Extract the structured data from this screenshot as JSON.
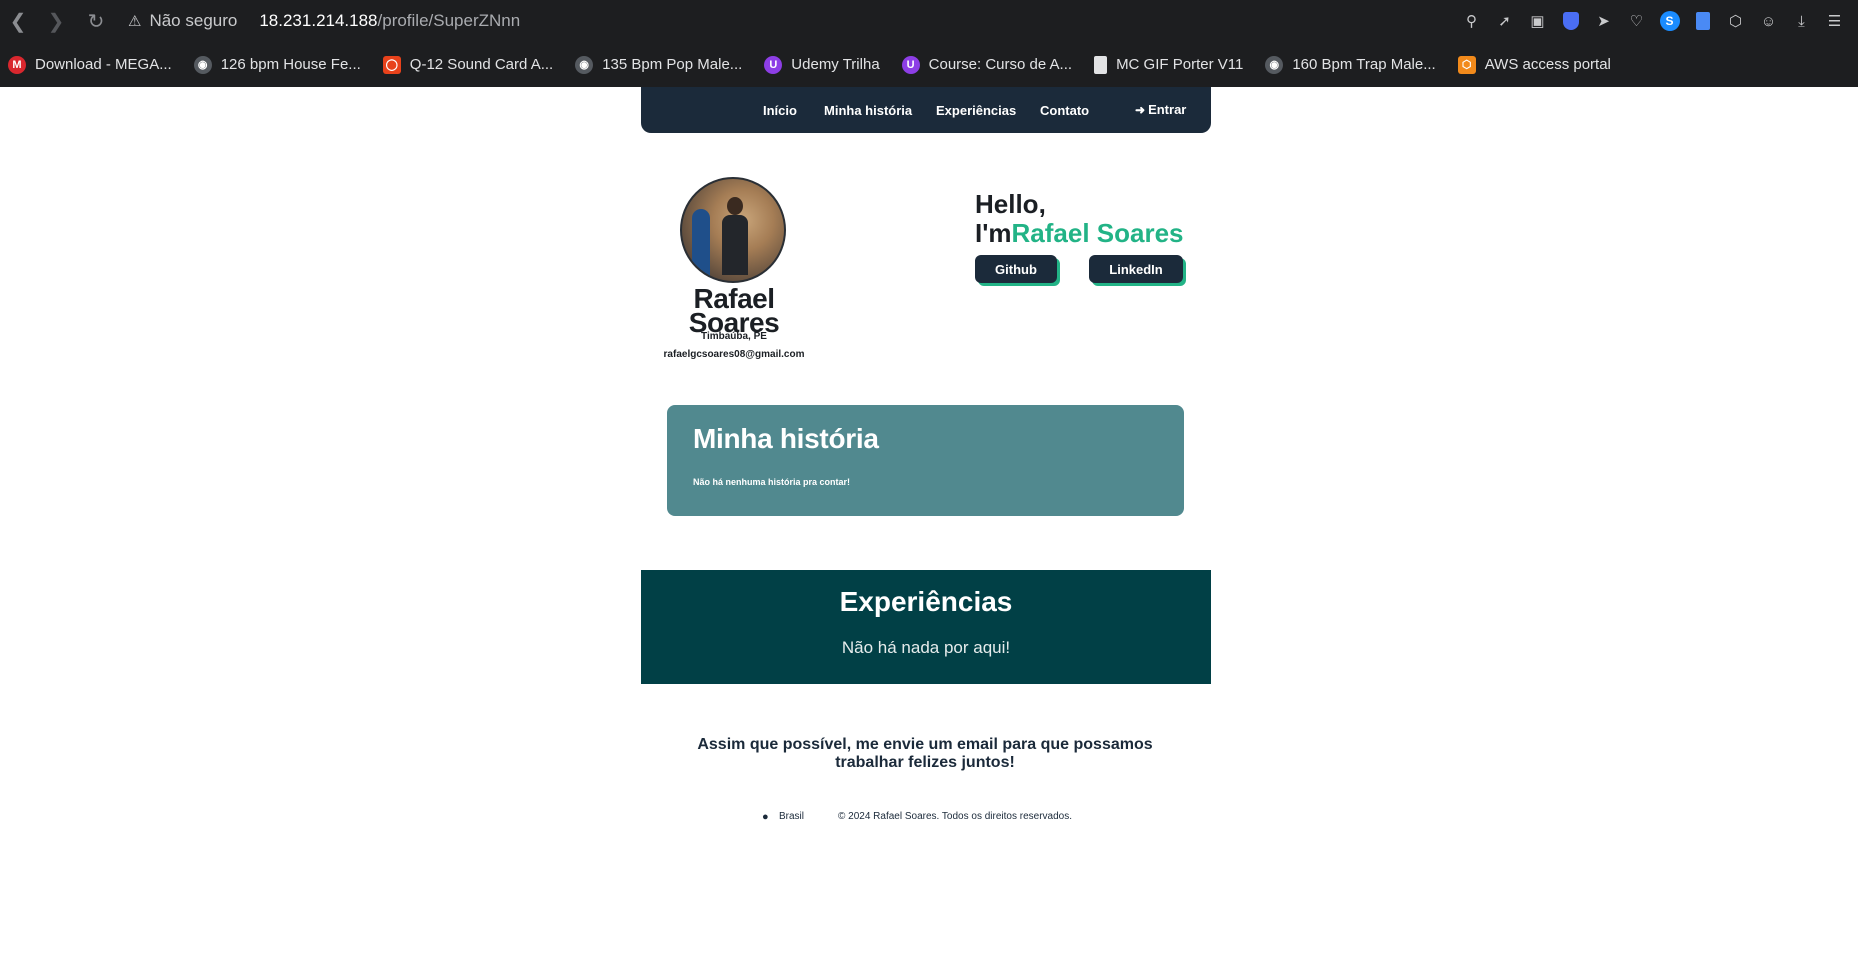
{
  "browser": {
    "security_label": "Não seguro",
    "url_host": "18.231.214.188",
    "url_path": "/profile/SuperZNnn",
    "bookmarks": [
      {
        "label": "Download - MEGA...",
        "icon": "mega-icon",
        "color": "#d9272e"
      },
      {
        "label": "126 bpm House Fe...",
        "icon": "cartoon-icon",
        "color": "#555a60"
      },
      {
        "label": "Q-12 Sound Card A...",
        "icon": "aliexpress-icon",
        "color": "#e8421b"
      },
      {
        "label": "135 Bpm Pop Male...",
        "icon": "cartoon-icon",
        "color": "#555a60"
      },
      {
        "label": "Udemy Trilha",
        "icon": "udemy-icon",
        "color": "#8d3ee6"
      },
      {
        "label": "Course: Curso de A...",
        "icon": "udemy-icon",
        "color": "#8d3ee6"
      },
      {
        "label": "MC GIF Porter V11",
        "icon": "file-icon",
        "color": "#e2e3e5"
      },
      {
        "label": "160 Bpm Trap Male...",
        "icon": "cartoon-icon",
        "color": "#555a60"
      },
      {
        "label": "AWS access portal",
        "icon": "aws-icon",
        "color": "#f28a1b"
      }
    ]
  },
  "nav": {
    "inicio": "Início",
    "historia": "Minha história",
    "experiencias": "Experiências",
    "contato": "Contato",
    "entrar": "Entrar"
  },
  "profile": {
    "name": "Rafael Soares",
    "city": "Timbaúba, PE",
    "email": "rafaelgcsoares08@gmail.com"
  },
  "hero": {
    "hello": "Hello,",
    "im": "I'm",
    "name": "Rafael Soares",
    "github": "Github",
    "linkedin": "LinkedIn"
  },
  "story": {
    "title": "Minha história",
    "text": "Não há nenhuma história pra contar!"
  },
  "experiences": {
    "title": "Experiências",
    "text": "Não há nada por aqui!"
  },
  "contact": {
    "message": "Assim que possível, me envie um email para que possamos trabalhar felizes juntos!"
  },
  "footer": {
    "location": "Brasil",
    "copyright": "© 2024 Rafael Soares. Todos os direitos reservados."
  },
  "colors": {
    "accent": "#22b386",
    "navy": "#1b2a3a",
    "story_bg": "#51898f",
    "exp_bg": "#014046"
  }
}
